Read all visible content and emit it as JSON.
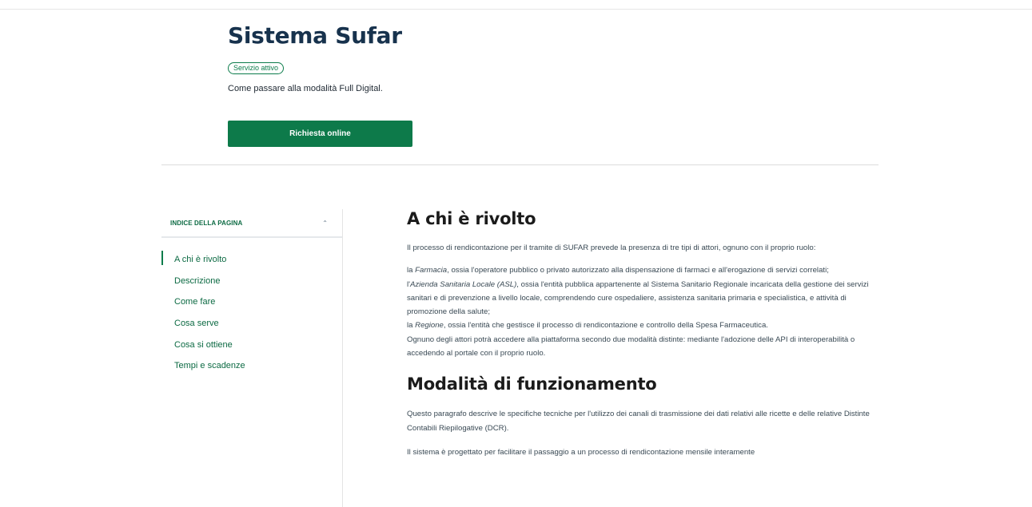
{
  "hero": {
    "title": "Sistema Sufar",
    "status_badge": "Servizio attivo",
    "description": "Come passare alla modalità Full Digital.",
    "cta_label": "Richiesta online"
  },
  "toc": {
    "title": "INDICE DELLA PAGINA",
    "items": [
      {
        "label": "A chi è rivolto",
        "active": true
      },
      {
        "label": "Descrizione"
      },
      {
        "label": "Come fare"
      },
      {
        "label": "Cosa serve"
      },
      {
        "label": "Cosa si ottiene"
      },
      {
        "label": "Tempi e scadenze"
      }
    ]
  },
  "sections": {
    "who": {
      "title": "A chi è rivolto",
      "intro": "Il processo di rendicontazione per il tramite di SUFAR prevede la presenza di tre tipi di attori, ognuno con il proprio ruolo:",
      "farmacia_prefix": "la ",
      "farmacia_term": "Farmacia",
      "farmacia_text": ", ossia l'operatore pubblico o privato autorizzato alla dispensazione di farmaci e all'erogazione di servizi correlati;",
      "asl_prefix": "l'",
      "asl_term": "Azienda Sanitaria Locale (ASL)",
      "asl_text": ", ossia l'entità pubblica appartenente al Sistema Sanitario Regionale incaricata della gestione dei servizi sanitari e di prevenzione a livello locale, comprendendo cure ospedaliere, assistenza sanitaria primaria e specialistica, e attività di promozione della salute;",
      "regione_prefix": "la ",
      "regione_term": "Regione",
      "regione_text": ", ossia l'entità che gestisce il processo di rendicontazione e controllo della Spesa Farmaceutica.",
      "closing": "Ognuno degli attori potrà accedere alla piattaforma secondo due modalità distinte: mediante l'adozione delle API di interoperabilità o accedendo al portale con il proprio ruolo."
    },
    "modes": {
      "title": "Modalità di funzionamento",
      "paragraph": "Questo paragrafo descrive le specifiche tecniche per l'utilizzo dei canali di trasmissione dei dati relativi alle ricette e delle relative Distinte Contabili Riepilogative (DCR).",
      "partial": "Il sistema è progettato per facilitare il passaggio a un processo di rendicontazione mensile interamente"
    }
  },
  "colors": {
    "primary_green": "#0d7a4a",
    "link_green": "#0c6a43",
    "heading_dark": "#17324d"
  },
  "icons": {
    "toc_toggle": "chevron-up-icon"
  }
}
